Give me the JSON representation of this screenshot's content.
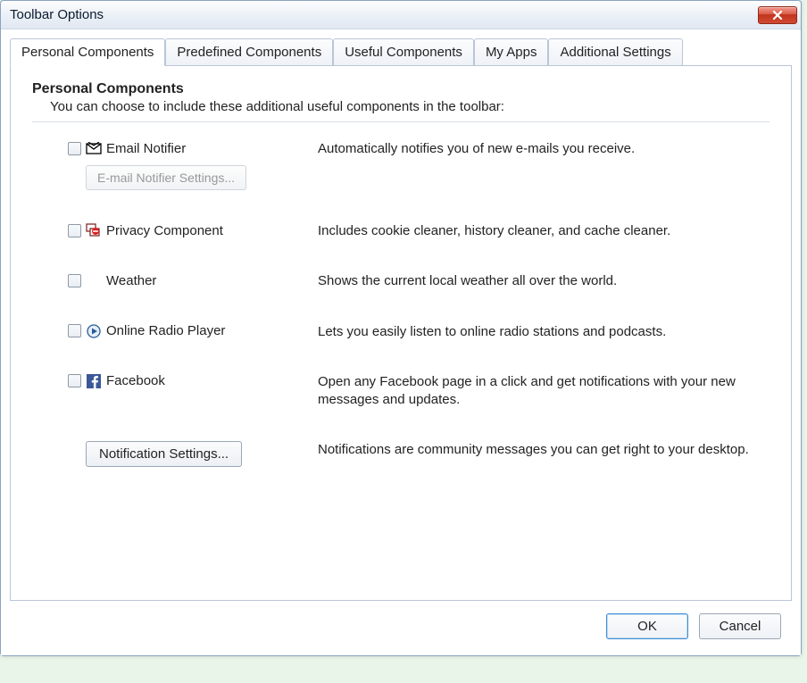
{
  "window": {
    "title": "Toolbar Options"
  },
  "tabs": [
    {
      "label": "Personal Components",
      "active": true
    },
    {
      "label": "Predefined Components",
      "active": false
    },
    {
      "label": "Useful Components",
      "active": false
    },
    {
      "label": "My Apps",
      "active": false
    },
    {
      "label": "Additional Settings",
      "active": false
    }
  ],
  "section": {
    "title": "Personal Components",
    "description": "You can choose to include these additional useful components in the toolbar:"
  },
  "components": [
    {
      "id": "email-notifier",
      "label": "Email Notifier",
      "description": "Automatically notifies you of new e-mails you receive.",
      "icon": "envelope-icon",
      "sub_button": "E-mail Notifier Settings..."
    },
    {
      "id": "privacy-component",
      "label": "Privacy Component",
      "description": "Includes cookie cleaner, history cleaner, and cache cleaner.",
      "icon": "privacy-icon"
    },
    {
      "id": "weather",
      "label": "Weather",
      "description": "Shows the current local weather all over the world.",
      "icon": ""
    },
    {
      "id": "online-radio-player",
      "label": "Online Radio Player",
      "description": "Lets you easily listen to online radio stations and podcasts.",
      "icon": "play-circle-icon"
    },
    {
      "id": "facebook",
      "label": "Facebook",
      "description": "Open any Facebook page in a click and get notifications with your new messages and updates.",
      "icon": "facebook-icon"
    }
  ],
  "notification": {
    "button": "Notification Settings...",
    "description": "Notifications are community messages you can get right to your desktop."
  },
  "buttons": {
    "ok": "OK",
    "cancel": "Cancel"
  }
}
